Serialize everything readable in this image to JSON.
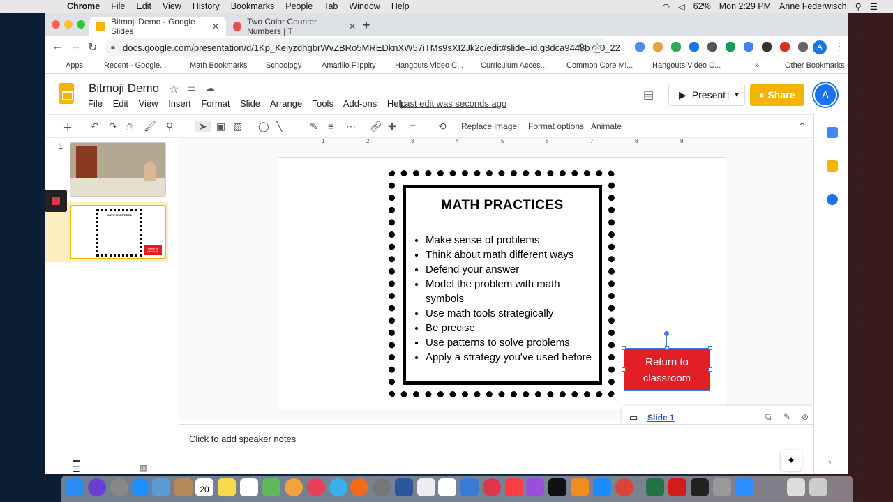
{
  "menubar": {
    "app": "Chrome",
    "items": [
      "File",
      "Edit",
      "View",
      "History",
      "Bookmarks",
      "People",
      "Tab",
      "Window",
      "Help"
    ],
    "battery": "62%",
    "clock": "Mon 2:29 PM",
    "user": "Anne Federwisch"
  },
  "tabs": [
    {
      "title": "Bitmoji Demo - Google Slides"
    },
    {
      "title": "Two Color Counter Numbers | T"
    }
  ],
  "address": {
    "url": "docs.google.com/presentation/d/1Kp_KeiyzdhgbrWvZBRo5MREDknXW57iTMs9sXI2Jk2c/edit#slide=id.g8dca9448b7_0_22"
  },
  "bookmarks": [
    "Apps",
    "Recent - Google...",
    "Math Bookmarks",
    "Schoology",
    "Amarillo Flippity",
    "Hangouts Video C...",
    "Curriculum Acces...",
    "Common Core Mi...",
    "Hangouts Video C..."
  ],
  "other_bookmarks": "Other Bookmarks",
  "doc": {
    "title": "Bitmoji Demo",
    "menus": [
      "File",
      "Edit",
      "View",
      "Insert",
      "Format",
      "Slide",
      "Arrange",
      "Tools",
      "Add-ons",
      "Help"
    ],
    "last_edit": "Last edit was seconds ago",
    "present": "Present",
    "share": "Share",
    "avatar": "A"
  },
  "toolbar": {
    "replace_image": "Replace image",
    "format_options": "Format options",
    "animate": "Animate"
  },
  "ruler": [
    "1",
    "2",
    "3",
    "4",
    "5",
    "6",
    "7",
    "8",
    "9"
  ],
  "filmstrip": {
    "slide_number": "1",
    "thumb2_title": "MATH PRACTICES",
    "thumb2_button": "Return to classroom"
  },
  "slide": {
    "title": "MATH PRACTICES",
    "items": [
      "Make sense of problems",
      "Think about math different ways",
      "Defend your answer",
      "Model the problem with math symbols",
      "Use math tools strategically",
      "Be precise",
      "Use patterns to solve problems",
      "Apply a strategy you've used before"
    ],
    "button_line1": "Return to",
    "button_line2": "classroom"
  },
  "link_popup": {
    "label": "Slide 1"
  },
  "notes": {
    "placeholder": "Click to add speaker notes"
  },
  "dock": {
    "calendar_day": "20"
  }
}
